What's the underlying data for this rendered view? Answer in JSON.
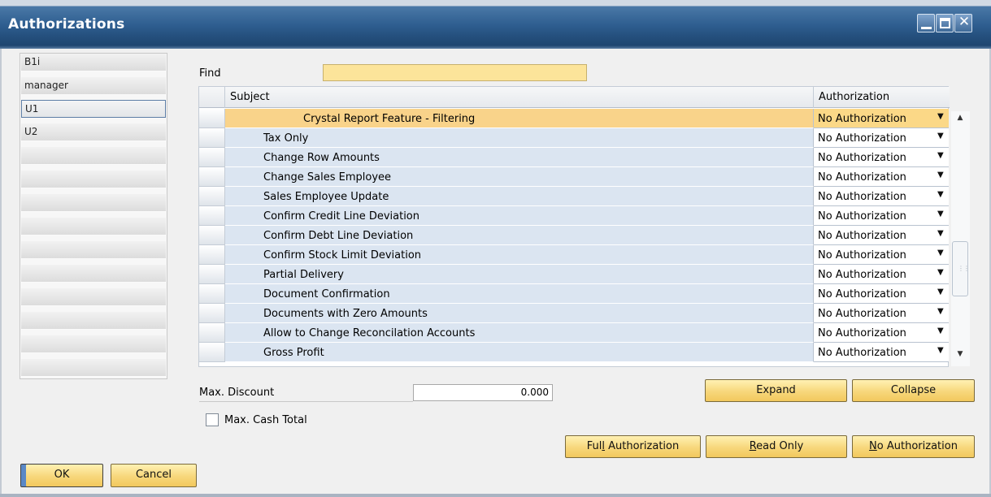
{
  "window": {
    "title": "Authorizations",
    "controls": {
      "minimize": "minimize-icon",
      "maximize": "maximize-icon",
      "close": "close-icon"
    }
  },
  "users": [
    {
      "label": "B1i",
      "selected": false
    },
    {
      "label": "manager",
      "selected": false
    },
    {
      "label": "U1",
      "selected": true
    },
    {
      "label": "U2",
      "selected": false
    }
  ],
  "find": {
    "label": "Find",
    "value": ""
  },
  "grid": {
    "headers": {
      "row": "",
      "subject": "Subject",
      "authorization": "Authorization"
    },
    "rows": [
      {
        "subject": "Crystal Report Feature - Filtering",
        "authorization": "No Authorization",
        "highlighted": true
      },
      {
        "subject": "Tax Only",
        "authorization": "No Authorization"
      },
      {
        "subject": "Change Row Amounts",
        "authorization": "No Authorization"
      },
      {
        "subject": "Change Sales Employee",
        "authorization": "No Authorization"
      },
      {
        "subject": "Sales Employee Update",
        "authorization": "No Authorization"
      },
      {
        "subject": "Confirm Credit Line Deviation",
        "authorization": "No Authorization"
      },
      {
        "subject": "Confirm Debt Line Deviation",
        "authorization": "No Authorization"
      },
      {
        "subject": "Confirm Stock Limit Deviation",
        "authorization": "No Authorization"
      },
      {
        "subject": "Partial Delivery",
        "authorization": "No Authorization"
      },
      {
        "subject": "Document Confirmation",
        "authorization": "No Authorization"
      },
      {
        "subject": "Documents with Zero Amounts",
        "authorization": "No Authorization"
      },
      {
        "subject": "Allow to Change Reconcilation Accounts",
        "authorization": "No Authorization"
      },
      {
        "subject": "Gross Profit",
        "authorization": "No Authorization"
      }
    ],
    "dropdown_icon": "chevron-down-icon"
  },
  "max_discount": {
    "label": "Max. Discount",
    "value": "0.000"
  },
  "max_cash_total": {
    "label": "Max. Cash Total",
    "checked": false
  },
  "buttons": {
    "expand": "Expand",
    "collapse": "Collapse",
    "full_authorization": {
      "before": "Ful",
      "underlined": "l",
      "after": " Authorization"
    },
    "read_only": {
      "before": "",
      "underlined": "R",
      "after": "ead Only"
    },
    "no_authorization": {
      "before": "",
      "underlined": "N",
      "after": "o Authorization"
    },
    "ok": "OK",
    "cancel": "Cancel"
  },
  "colors": {
    "title_bar": "#2f5f91",
    "highlight_row": "#f9d38a",
    "find_field": "#fce49a",
    "button": "#f7d77b",
    "subject_cell": "#dbe5f1"
  }
}
